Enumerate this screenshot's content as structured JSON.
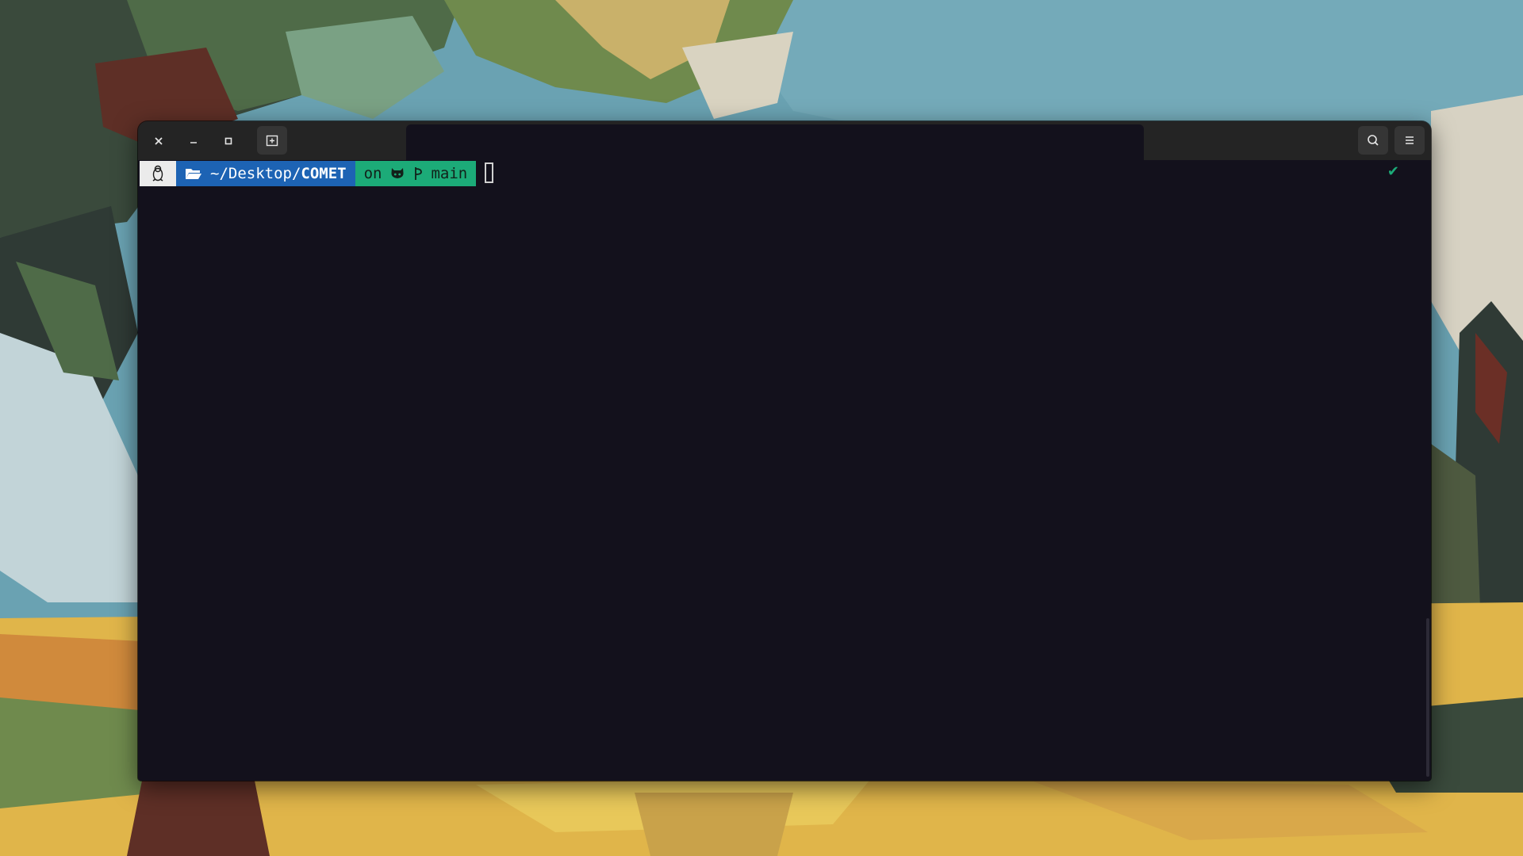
{
  "window": {
    "tab_title": ""
  },
  "prompt": {
    "os_icon": "tux-icon",
    "folder_icon": "folder-open-icon",
    "path_prefix": "~/Desktop/",
    "path_current": "COMET",
    "git_on": "on",
    "git_host_icon": "github-icon",
    "git_branch_icon": "branch-icon",
    "git_branch": "main",
    "status_icon": "check-icon",
    "status_text": "✔"
  },
  "colors": {
    "terminal_bg": "#13111c",
    "titlebar_bg": "#242424",
    "segment_os": "#ebebeb",
    "segment_dir": "#1d63b4",
    "segment_git": "#1cab78",
    "status_ok": "#1cab78"
  }
}
